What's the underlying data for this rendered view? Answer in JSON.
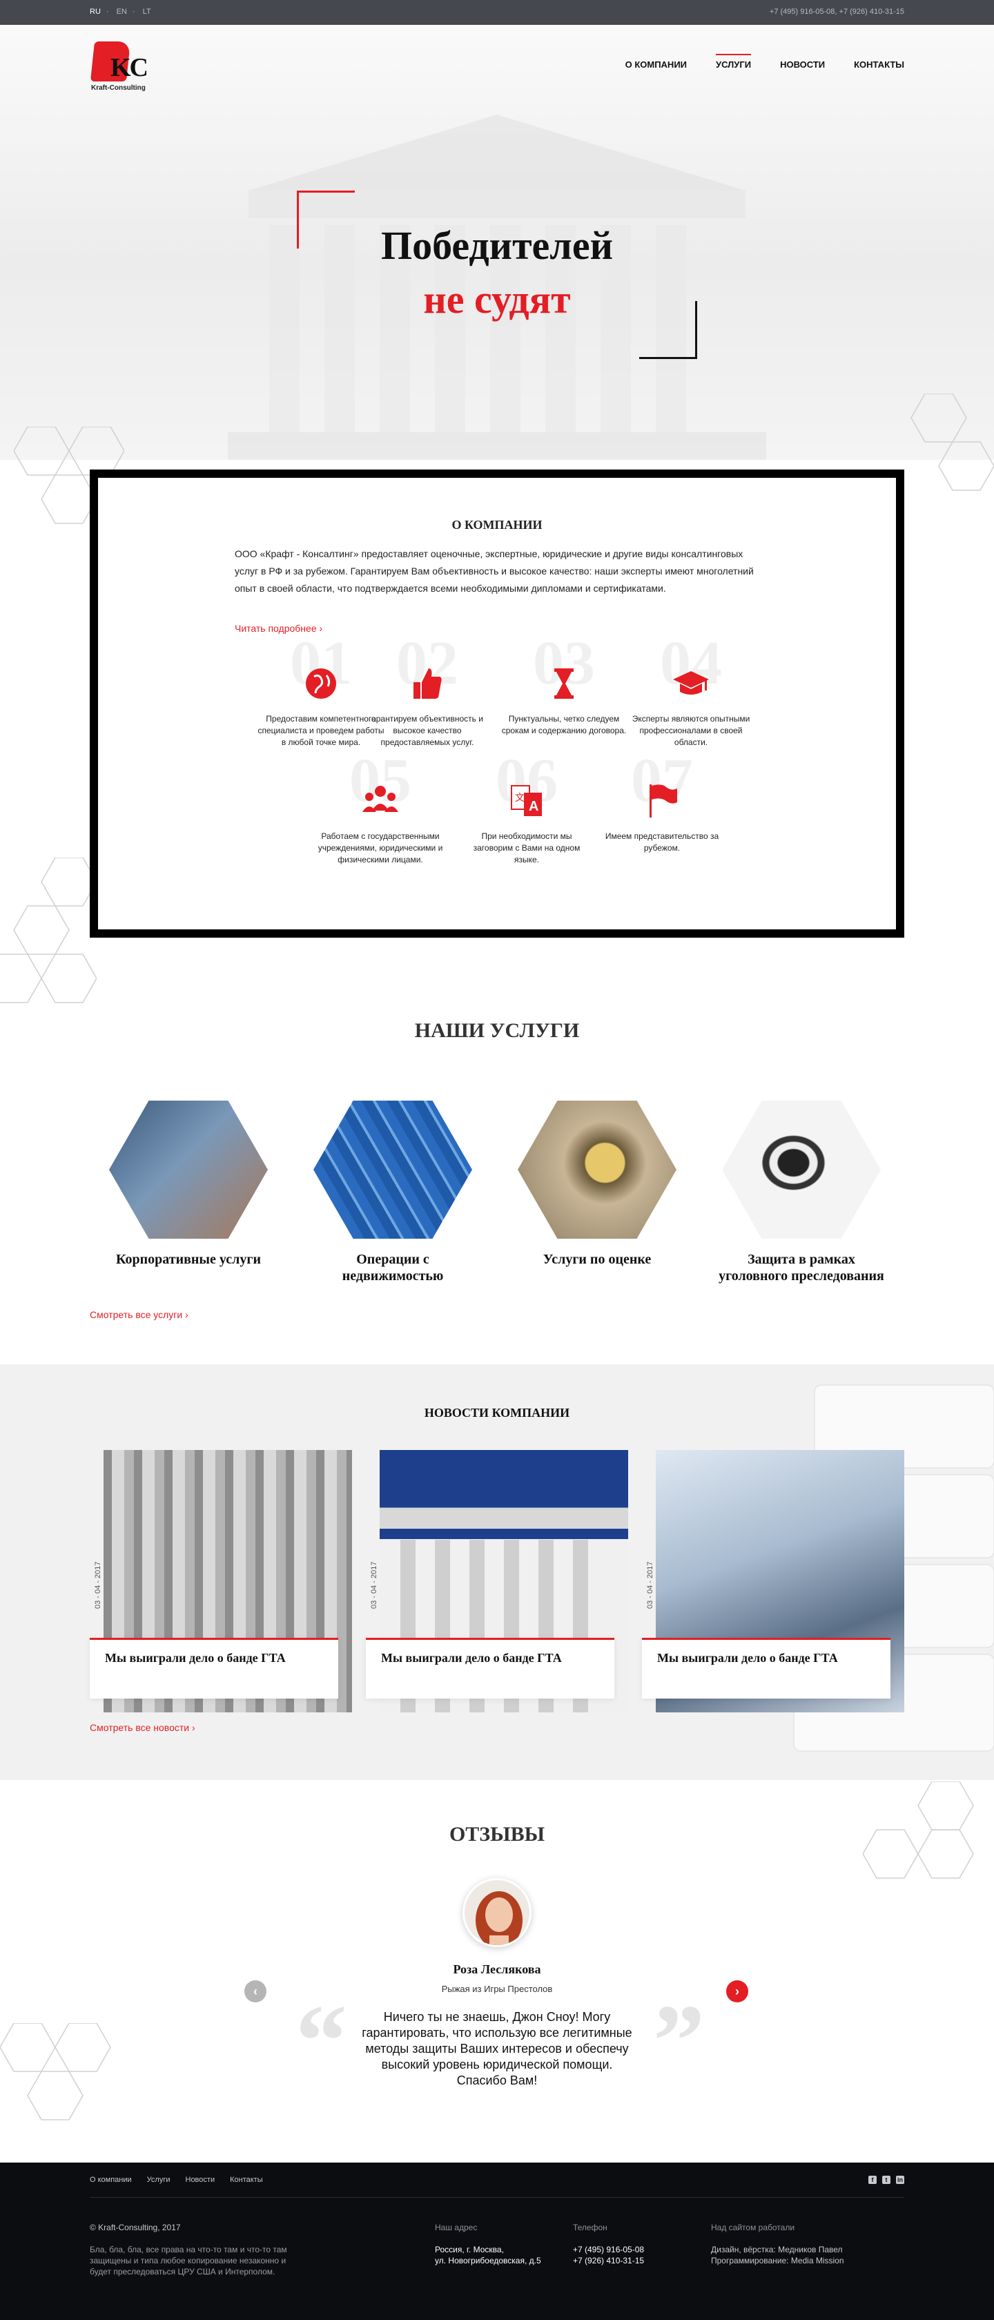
{
  "topbar": {
    "langs": [
      "RU",
      "EN",
      "LT"
    ],
    "phones": "+7 (495) 916-05-08, +7 (926) 410-31-15"
  },
  "logo": {
    "letters": "KC",
    "name": "Kraft-Consulting"
  },
  "nav": [
    "О КОМПАНИИ",
    "УСЛУГИ",
    "НОВОСТИ",
    "КОНТАКТЫ"
  ],
  "hero": {
    "line1": "Победителей",
    "line2": "не судят"
  },
  "about": {
    "title": "О КОМПАНИИ",
    "text": "ООО «Крафт - Консалтинг» предоставляет оценочные, экспертные, юридические и другие виды консалтинговых услуг в РФ и за рубежом. Гарантируем Вам объективность и высокое качество: наши эксперты имеют многолетний опыт в своей области, что подтверждается всеми необходимыми дипломами и сертификатами.",
    "more": "Читать подробнее ›",
    "features": [
      {
        "num": "01",
        "icon": "globe-icon",
        "text": "Предоставим компетентного специалиста и проведем работы в любой точке мира."
      },
      {
        "num": "02",
        "icon": "thumbs-up-icon",
        "text": "арантируем объективность и высокое качество предоставляемых услуг."
      },
      {
        "num": "03",
        "icon": "hourglass-icon",
        "text": "Пунктуальны, четко следуем срокам и содержанию договора."
      },
      {
        "num": "04",
        "icon": "graduation-cap-icon",
        "text": "Эксперты являются опытными профессионалами в своей области."
      },
      {
        "num": "05",
        "icon": "people-icon",
        "text": "Работаем с государственными учреждениями, юридическими и физическими лицами."
      },
      {
        "num": "06",
        "icon": "translate-icon",
        "text": "При необходимости мы заговорим с Вами на одном языке."
      },
      {
        "num": "07",
        "icon": "flag-icon",
        "text": "Имеем представительство за рубежом."
      }
    ]
  },
  "services": {
    "title": "НАШИ УСЛУГИ",
    "items": [
      {
        "label": "Корпоративные услуги",
        "active": false
      },
      {
        "label": "Операции с недвижимостью",
        "active": true
      },
      {
        "label": "Услуги по оценке",
        "active": false
      },
      {
        "label": "Защита в рамках уголовного преследования",
        "active": false
      }
    ],
    "all": "Смотреть все услуги ›"
  },
  "news": {
    "title": "НОВОСТИ КОМПАНИИ",
    "items": [
      {
        "date": "03 - 04 - 2017",
        "title": "Мы выиграли дело о банде ГТА"
      },
      {
        "date": "03 - 04 - 2017",
        "title": "Мы выиграли дело о банде ГТА"
      },
      {
        "date": "03 - 04 - 2017",
        "title": "Мы выиграли дело о банде ГТА"
      }
    ],
    "all": "Смотреть все новости ›"
  },
  "reviews": {
    "title": "ОТЗЫВЫ",
    "name": "Роза Леслякова",
    "role": "Рыжая из Игры Престолов",
    "text": "Ничего ты не знаешь, Джон Сноу! Могу гарантировать, что использую все легитимные методы защиты Ваших интересов и обеспечу высокий уровень юридической помощи. Спасибо Вам!",
    "prev": "‹",
    "next": "›"
  },
  "footer": {
    "links": [
      "О компании",
      "Услуги",
      "Новости",
      "Контакты"
    ],
    "social": [
      "f",
      "t",
      "in"
    ],
    "copyright": "© Kraft-Consulting, 2017",
    "legal": "Бла, бла, бла, все права на что-то там и что-то там защищены и типа любое копирование незаконно и будет преследоваться ЦРУ США и Интерполом.",
    "address_label": "Наш адрес",
    "address_1": "Россия, г. Москва,",
    "address_2": "ул. Новогрибоедовская, д.5",
    "phone_label": "Телефон",
    "phone_1": "+7 (495) 916-05-08",
    "phone_2": "+7 (926) 410-31-15",
    "credits_label": "Над сайтом работали",
    "credits_1": "Дизайн, вёрстка: Медников Павел",
    "credits_2": "Программирование: Media Mission"
  },
  "colors": {
    "accent": "#e31e24",
    "topbar": "#45484f",
    "footer": "#0c0d11"
  }
}
